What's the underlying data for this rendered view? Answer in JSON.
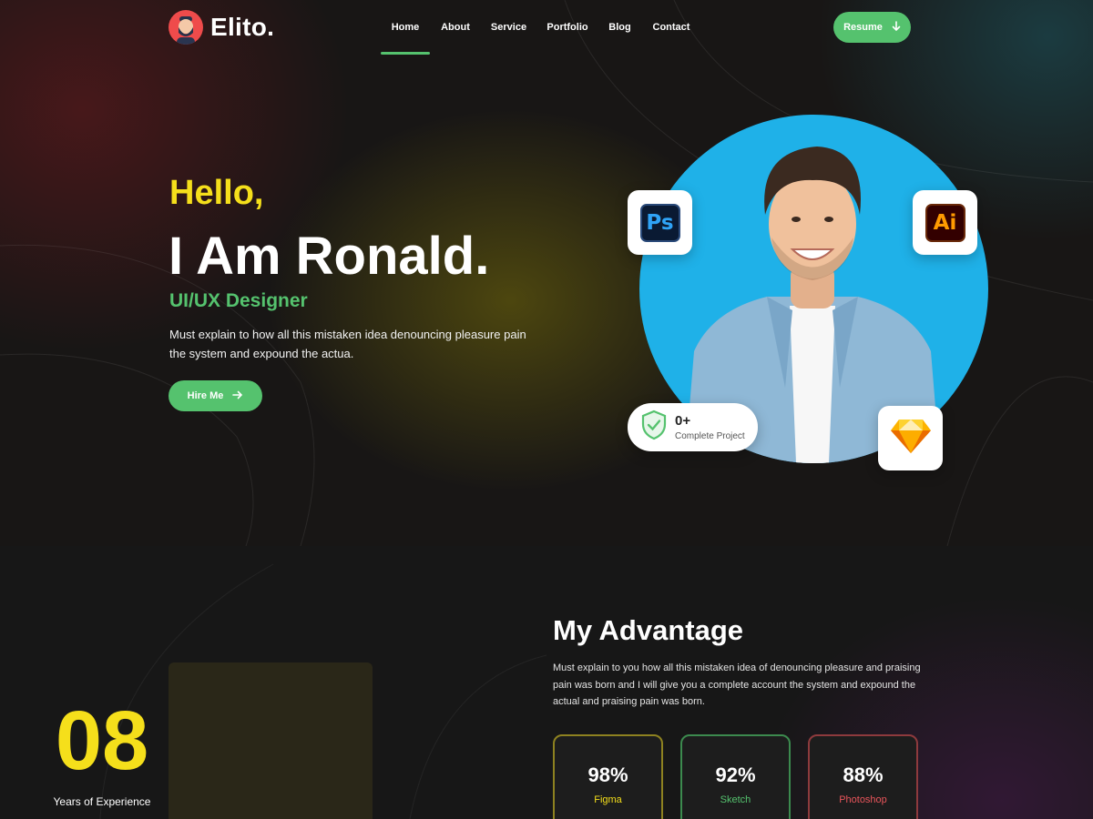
{
  "brand": {
    "name": "Elito."
  },
  "nav": {
    "items": [
      {
        "label": "Home",
        "active": true
      },
      {
        "label": "About"
      },
      {
        "label": "Service"
      },
      {
        "label": "Portfolio"
      },
      {
        "label": "Blog"
      },
      {
        "label": "Contact"
      }
    ]
  },
  "header": {
    "resume_label": "Resume",
    "resume_icon": "arrow-down-icon"
  },
  "hero": {
    "greeting": "Hello,",
    "name": "I Am Ronald.",
    "role": "UI/UX Designer",
    "description": "Must explain to how all this mistaken idea denouncing pleasure pain the system and expound the actua.",
    "hire_label": "Hire Me",
    "hire_icon": "arrow-right-icon",
    "tools": {
      "photoshop": "Ps",
      "illustrator": "Ai"
    },
    "project_badge": {
      "count": "0+",
      "label": "Complete Project",
      "icon": "shield-check-icon"
    }
  },
  "advantage": {
    "experience": {
      "value": "08",
      "label": "Years of Experience"
    },
    "title": "My Advantage",
    "description": "Must explain to you how all this mistaken idea of denouncing pleasure and praising pain was born and I will give you a complete account the system and expound the actual and praising pain was born.",
    "skills": [
      {
        "value": "98%",
        "name": "Figma",
        "color": "#f5df1b",
        "border": "#8e8220"
      },
      {
        "value": "92%",
        "name": "Sketch",
        "color": "#55c26e",
        "border": "#3c8a4e"
      },
      {
        "value": "88%",
        "name": "Photoshop",
        "color": "#e9555b",
        "border": "#8e3a3d"
      }
    ]
  },
  "colors": {
    "accent_green": "#55c26e",
    "accent_yellow": "#f5df1b",
    "portrait_blue": "#1fb1e8"
  }
}
